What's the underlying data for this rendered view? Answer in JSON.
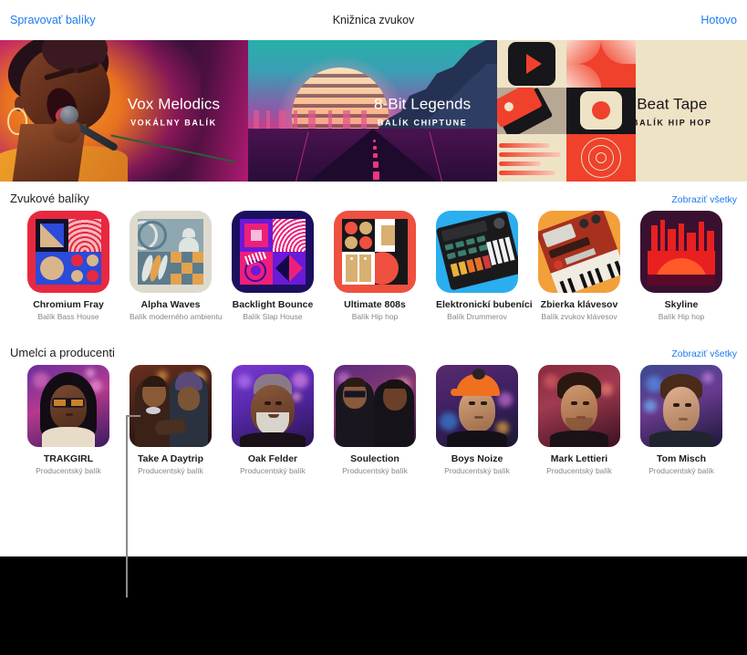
{
  "header": {
    "manage_label": "Spravovať balíky",
    "title": "Knižnica zvukov",
    "done_label": "Hotovo"
  },
  "heroes": [
    {
      "title": "Vox Melodics",
      "subtitle": "VOKÁLNY BALÍK",
      "art": "vocal-singer-artwork"
    },
    {
      "title": "8-Bit Legends",
      "subtitle": "BALÍK CHIPTUNE",
      "art": "synthwave-sunset-artwork"
    },
    {
      "title": "Beat Tape",
      "subtitle": "BALÍK HIP HOP",
      "art": "geometric-beat-tape-artwork"
    }
  ],
  "sections": [
    {
      "title": "Zvukové balíky",
      "see_all": "Zobraziť všetky",
      "items": [
        {
          "title": "Chromium Fray",
          "subtitle": "Balík Bass House"
        },
        {
          "title": "Alpha Waves",
          "subtitle": "Balík moderného ambientu"
        },
        {
          "title": "Backlight Bounce",
          "subtitle": "Balík Slap House"
        },
        {
          "title": "Ultimate 808s",
          "subtitle": "Balík Hip hop"
        },
        {
          "title": "Elektronickí bubeníci",
          "subtitle": "Balík Drummerov"
        },
        {
          "title": "Zbierka klávesov",
          "subtitle": "Balík zvukov klávesov"
        },
        {
          "title": "Skyline",
          "subtitle": "Balík Hip hop"
        }
      ]
    },
    {
      "title": "Umelci a producenti",
      "see_all": "Zobraziť všetky",
      "items": [
        {
          "title": "TRAKGIRL",
          "subtitle": "Producentský balík"
        },
        {
          "title": "Take A Daytrip",
          "subtitle": "Producentský balík"
        },
        {
          "title": "Oak Felder",
          "subtitle": "Producentský balík"
        },
        {
          "title": "Soulection",
          "subtitle": "Producentský balík"
        },
        {
          "title": "Boys Noize",
          "subtitle": "Producentský balík"
        },
        {
          "title": "Mark Lettieri",
          "subtitle": "Producentský balík"
        },
        {
          "title": "Tom Misch",
          "subtitle": "Producentský balík"
        }
      ]
    }
  ],
  "colors": {
    "link": "#1a7bf0",
    "text": "#1d1d1f",
    "muted": "#86868b",
    "background": "#ffffff",
    "outside": "#000000",
    "callout": "#8b8b8b"
  }
}
